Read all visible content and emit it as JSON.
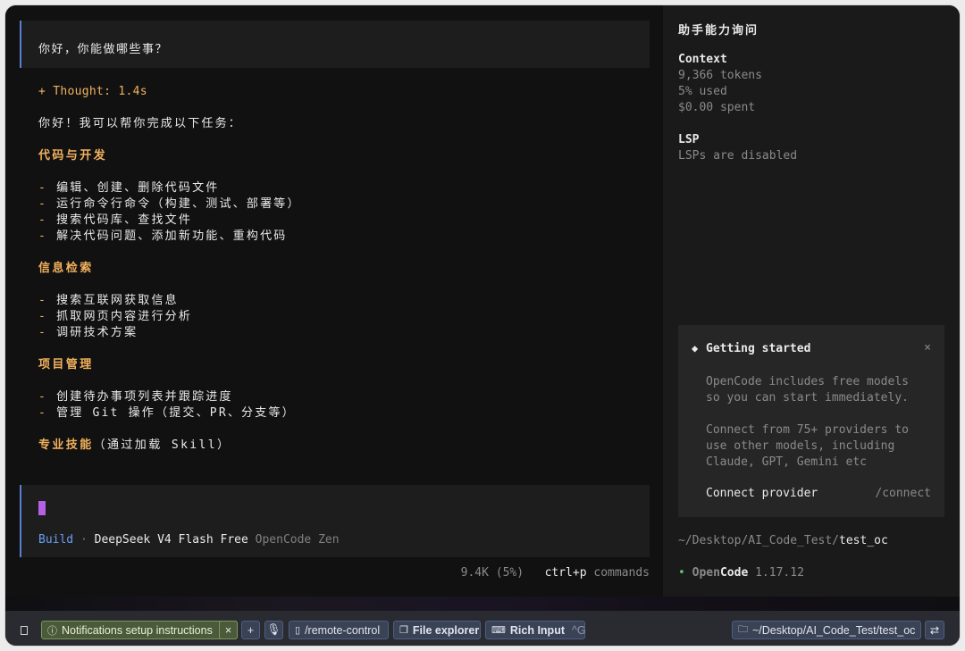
{
  "user_message": "你好，你能做哪些事？",
  "assistant": {
    "thought": "+ Thought: 1.4s",
    "intro": "你好！我可以帮你完成以下任务：",
    "sections": [
      {
        "heading": "代码与开发",
        "items": [
          "编辑、创建、删除代码文件",
          "运行命令行命令（构建、测试、部署等）",
          "搜索代码库、查找文件",
          "解决代码问题、添加新功能、重构代码"
        ]
      },
      {
        "heading": "信息检索",
        "items": [
          "搜索互联网获取信息",
          "抓取网页内容进行分析",
          "调研技术方案"
        ]
      },
      {
        "heading": "项目管理",
        "items": [
          "创建待办事项列表并跟踪进度",
          "管理 Git 操作（提交、PR、分支等）"
        ]
      }
    ],
    "final_heading": "专业技能",
    "final_suffix": "（通过加载 Skill）"
  },
  "input": {
    "mode": "Build",
    "separator": "·",
    "model": "DeepSeek V4 Flash Free",
    "provider": "OpenCode Zen"
  },
  "status": {
    "tokens": "9.4K (5%)",
    "shortcut_key": "ctrl+p",
    "shortcut_label": "commands"
  },
  "sidebar": {
    "title": "助手能力询问",
    "context_heading": "Context",
    "context_tokens": "9,366 tokens",
    "context_used": "5% used",
    "context_spent": "$0.00 spent",
    "lsp_heading": "LSP",
    "lsp_status": "LSPs are disabled",
    "getting_started": {
      "title": "Getting started",
      "close": "×",
      "text1_line1": "OpenCode includes free models",
      "text1_line2": "so you can start immediately.",
      "text2_line1": "Connect from 75+ providers to",
      "text2_line2": "use other models, including",
      "text2_line3": "Claude, GPT, Gemini etc",
      "connect_label": "Connect provider",
      "connect_command": "/connect"
    },
    "path_prefix": "~/Desktop/AI_Code_Test/",
    "path_last": "test_oc",
    "version_bullet": "•",
    "version_open": "Open",
    "version_code": "Code",
    "version_number": "1.17.12"
  },
  "bottombar": {
    "notification": "Notifications setup instructions",
    "notification_close": "×",
    "add": "+",
    "remote_control": "/remote-control",
    "file_explorer": "File explorer",
    "rich_input": "Rich Input",
    "rich_input_shortcut": "^G",
    "cwd": "~/Desktop/AI_Code_Test/test_oc"
  }
}
